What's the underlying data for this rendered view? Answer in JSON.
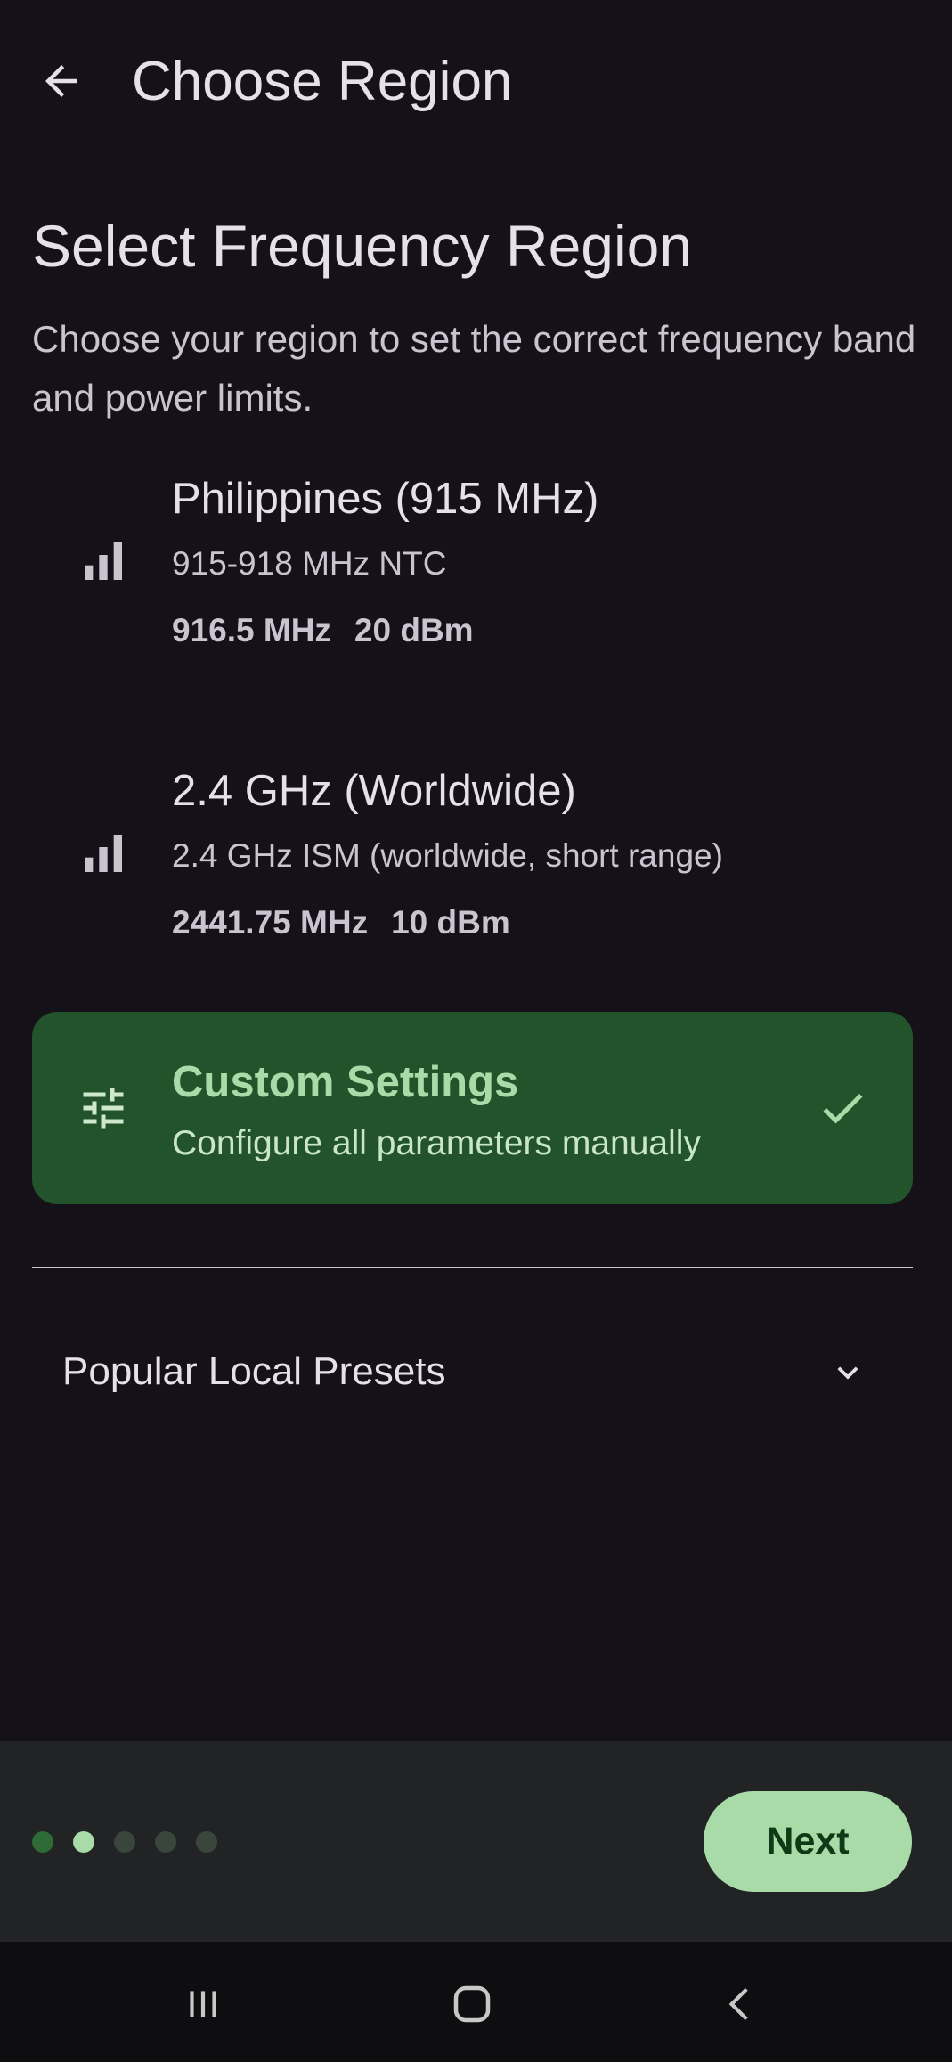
{
  "app_bar": {
    "title": "Choose Region",
    "back_icon": "arrow-left-icon"
  },
  "heading": "Select Frequency Region",
  "subtitle": "Choose your region to set the correct frequency band and power limits.",
  "regions": [
    {
      "name": "Philippines (915 MHz)",
      "description": "915-918 MHz NTC",
      "frequency": "916.5 MHz",
      "power": "20 dBm",
      "icon": "signal-bars-icon"
    },
    {
      "name": "2.4 GHz (Worldwide)",
      "description": "2.4 GHz ISM (worldwide, short range)",
      "frequency": "2441.75 MHz",
      "power": "10 dBm",
      "icon": "signal-bars-icon"
    }
  ],
  "custom": {
    "title": "Custom Settings",
    "description": "Configure all parameters manually",
    "selected": true,
    "icon": "tune-sliders-icon",
    "check_icon": "check-icon"
  },
  "presets": {
    "label": "Popular Local Presets",
    "icon": "chevron-down-icon"
  },
  "pager": {
    "total": 5,
    "current": 2
  },
  "next_label": "Next",
  "colors": {
    "background": "#141218",
    "selected_card": "#22532b",
    "accent": "#a8dba8",
    "bottom_bar": "#212325"
  }
}
